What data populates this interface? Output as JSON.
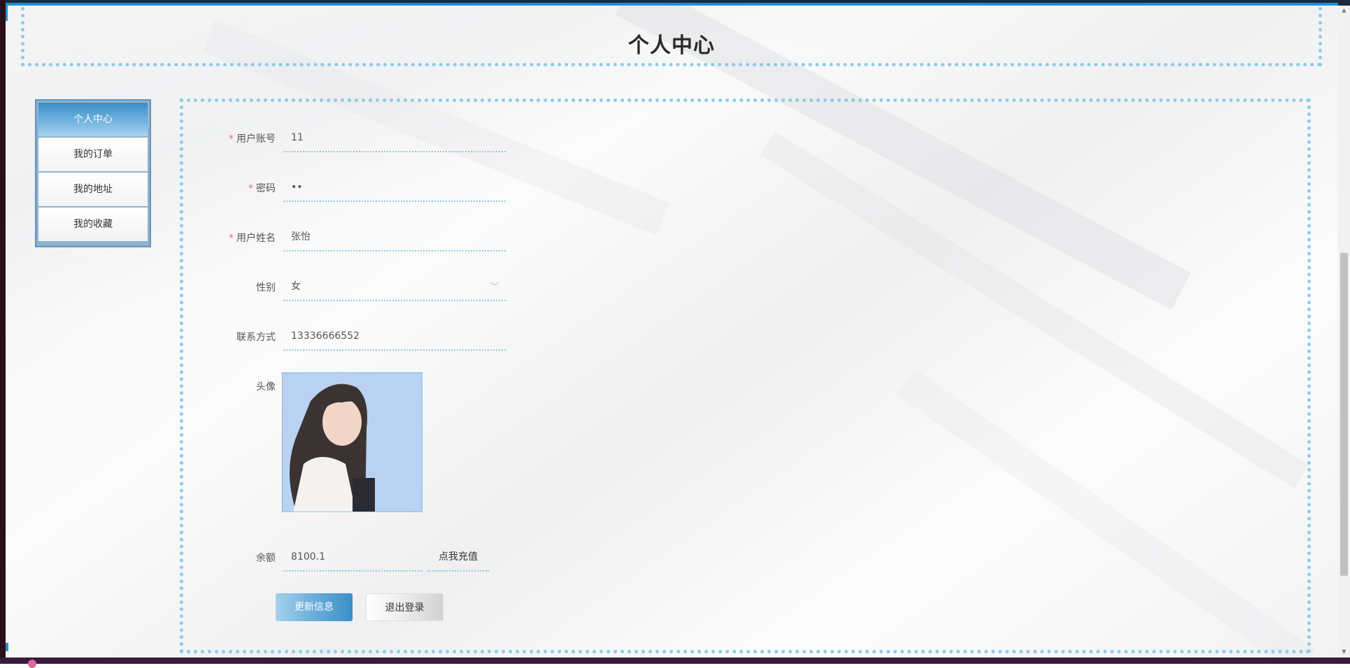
{
  "header": {
    "title": "个人中心"
  },
  "sidebar": {
    "items": [
      {
        "label": "个人中心"
      },
      {
        "label": "我的订单"
      },
      {
        "label": "我的地址"
      },
      {
        "label": "我的收藏"
      }
    ]
  },
  "form": {
    "account": {
      "label": "用户账号",
      "required_mark": "*",
      "value": "11"
    },
    "password": {
      "label": "密码",
      "required_mark": "*",
      "value": "••"
    },
    "name": {
      "label": "用户姓名",
      "required_mark": "*",
      "value": "张怡"
    },
    "gender": {
      "label": "性别",
      "value": "女"
    },
    "phone": {
      "label": "联系方式",
      "value": "13336666552"
    },
    "avatar": {
      "label": "头像"
    },
    "balance": {
      "label": "余额",
      "value": "8100.1",
      "recharge_label": "点我充值"
    }
  },
  "actions": {
    "update_label": "更新信息",
    "logout_label": "退出登录"
  },
  "icons": {
    "select_arrow": "chevron-down-icon"
  },
  "colors": {
    "accent": "#8ccbe9",
    "primary": "#3a8fc8",
    "required": "#f56c6c"
  }
}
